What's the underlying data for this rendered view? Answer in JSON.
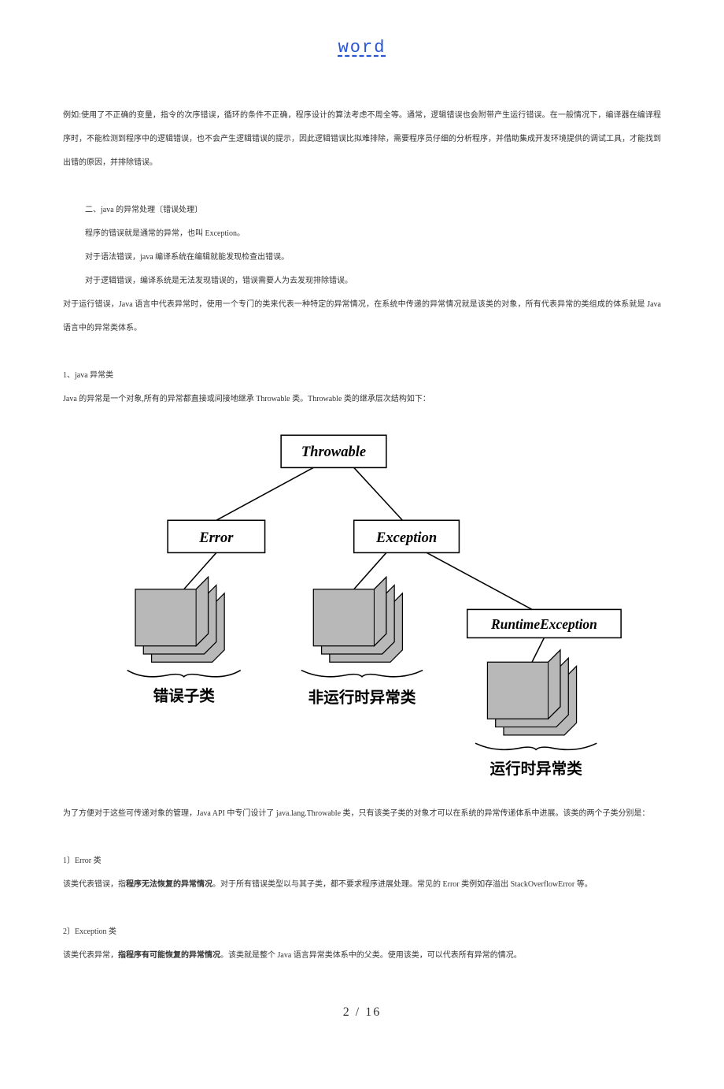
{
  "header": {
    "title": "word"
  },
  "intro": {
    "p1": "例如:使用了不正确的变量，指令的次序错误，循环的条件不正确，程序设计的算法考虑不周全等。通常，逻辑错误也会附带产生运行错误。在一般情况下，编译器在编译程序时，不能检测到程序中的逻辑错误，也不会产生逻辑错误的提示，因此逻辑错误比拟难排除，需要程序员仔细的分析程序，并借助集成开发环境提供的调试工具，才能找到出错的原因，并排除错误。"
  },
  "section2": {
    "title": "二、java 的异常处理〔错误处理〕",
    "p1": "程序的错误就是通常的异常，也叫 Exception。",
    "p2": "对于语法错误，java 编译系统在编辑就能发现检查出错误。",
    "p3": "对于逻辑错误，编译系统是无法发现错误的，错误需要人为去发现排除错误。",
    "p4": "对于运行错误，Java 语言中代表异常时，使用一个专门的类来代表一种特定的异常情况，在系统中传递的异常情况就是该类的对象，所有代表异常的类组成的体系就是 Java 语言中的异常类体系。"
  },
  "section3": {
    "title": "1、java 异常类",
    "p1": "Java 的异常是一个对象,所有的异常都直接或间接地继承 Throwable 类。Throwable 类的继承层次结构如下：",
    "p2": "为了方便对于这些可传递对象的管理，Java API 中专门设计了 java.lang.Throwable 类，只有该类子类的对象才可以在系统的异常传递体系中进展。该类的两个子类分别是："
  },
  "section4": {
    "title": "1〕Error 类",
    "p1_a": "该类代表错误，指",
    "p1_bold": "程序无法恢复的异常情况",
    "p1_b": "。对于所有错误类型以与其子类，都不要求程序进展处理。常见的 Error 类例如存溢出 StackOverflowError 等。"
  },
  "section5": {
    "title": "2〕Exception 类",
    "p1_a": "该类代表异常，",
    "p1_bold": "指程序有可能恢复的异常情况",
    "p1_b": "。该类就是整个 Java 语言异常类体系中的父类。使用该类，可以代表所有异常的情况。"
  },
  "diagram": {
    "throwable": "Throwable",
    "error": "Error",
    "exception": "Exception",
    "runtime": "RuntimeException",
    "label_error": "错误子类",
    "label_nonruntime": "非运行时异常类",
    "label_runtime": "运行时异常类"
  },
  "footer": {
    "page": "2 / 16"
  }
}
